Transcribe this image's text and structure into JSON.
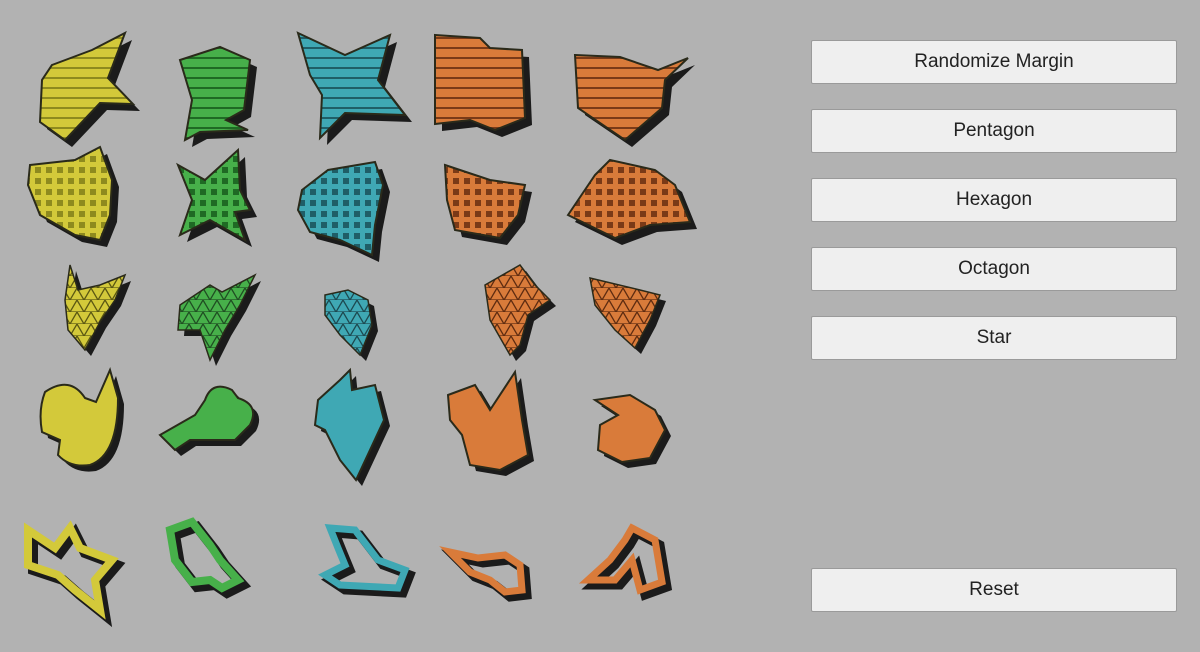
{
  "buttons": {
    "randomize_margin": "Randomize Margin",
    "pentagon": "Pentagon",
    "hexagon": "Hexagon",
    "octagon": "Octagon",
    "star": "Star",
    "reset": "Reset"
  },
  "colors": {
    "background": "#b2b2b2",
    "columns": [
      "#d3c93a",
      "#47b04a",
      "#3fa8b4",
      "#d97b3a",
      "#d97b3a"
    ],
    "outline": "#2a2a1a",
    "shadow": "#1b1b1b"
  },
  "grid": {
    "columns": 5,
    "rows": [
      "concentric-stripes",
      "grid-pattern",
      "triangle-mesh",
      "blob-solid",
      "outline-ring"
    ]
  }
}
